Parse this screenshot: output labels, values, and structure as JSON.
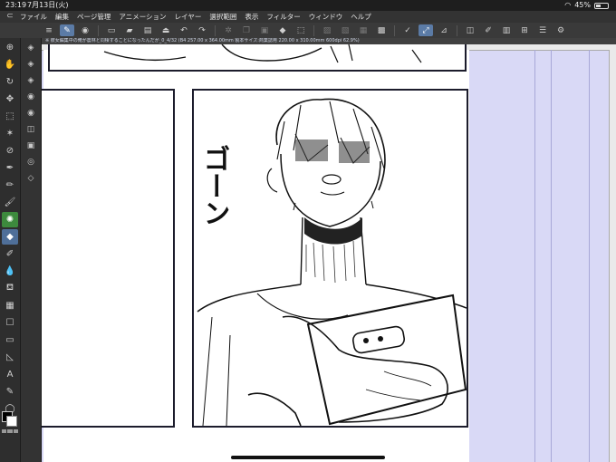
{
  "status": {
    "time": "23:19",
    "date": "7月13日(火)",
    "battery_label": "45%",
    "battery_level": 0.45
  },
  "menu": {
    "items": [
      "ファイル",
      "編集",
      "ページ管理",
      "アニメーション",
      "レイヤー",
      "選択範囲",
      "表示",
      "フィルター",
      "ウィンドウ",
      "ヘルプ"
    ]
  },
  "infobar": {
    "text": "※ 彼女編集中の俺が農林と同棲することになったんだが_0_4/32 (B4 257.00 x 364.00mm 製本サイズ:商業誌用 220.00 x 310.00mm 600dpi 62.9%)"
  },
  "manga": {
    "sfx": "ゴーン"
  },
  "colors": {
    "canvas_bg": "#d9d9f6",
    "ui_dark": "#2b2b2b",
    "accent": "#5b7ba6"
  }
}
